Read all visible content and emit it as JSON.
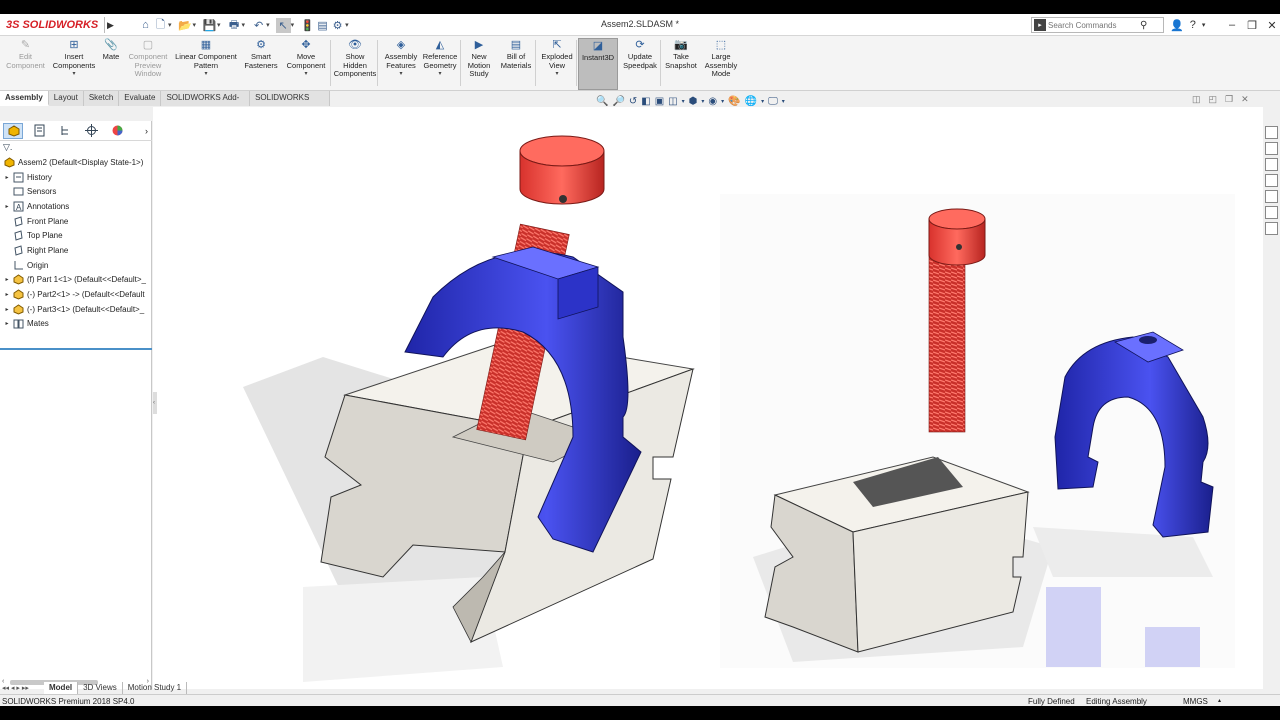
{
  "app": {
    "logo_ds": "3S",
    "logo_name": "SOLIDWORKS",
    "document_title": "Assem2.SLDASM *",
    "search_placeholder": "Search Commands"
  },
  "colors": {
    "brand_red": "#d61f26",
    "ribbon_active": "#bdbdbd",
    "part_red": "#e8463f",
    "part_blue": "#2a2fc4",
    "vblock": "#e8e6e0"
  },
  "ribbon": [
    {
      "label": "Edit\nComponent",
      "icon": "edit-component-icon",
      "disabled": true
    },
    {
      "label": "Insert\nComponents",
      "icon": "insert-components-icon",
      "dropdown": true
    },
    {
      "label": "Mate",
      "icon": "mate-icon"
    },
    {
      "label": "Component\nPreview\nWindow",
      "icon": "preview-window-icon",
      "disabled": true
    },
    {
      "label": "Linear Component\nPattern",
      "icon": "pattern-icon",
      "dropdown": true
    },
    {
      "label": "Smart\nFasteners",
      "icon": "fasteners-icon"
    },
    {
      "label": "Move\nComponent",
      "icon": "move-component-icon",
      "dropdown": true
    },
    {
      "label": "Show\nHidden\nComponents",
      "icon": "show-hidden-icon"
    },
    {
      "label": "Assembly\nFeatures",
      "icon": "assembly-features-icon",
      "dropdown": true
    },
    {
      "label": "Reference\nGeometry",
      "icon": "reference-geometry-icon",
      "dropdown": true
    },
    {
      "label": "New\nMotion\nStudy",
      "icon": "motion-study-icon"
    },
    {
      "label": "Bill of\nMaterials",
      "icon": "bom-icon"
    },
    {
      "label": "Exploded\nView",
      "icon": "exploded-view-icon",
      "dropdown": true
    },
    {
      "label": "Instant3D",
      "icon": "instant3d-icon",
      "active": true
    },
    {
      "label": "Update\nSpeedpak",
      "icon": "speedpak-icon"
    },
    {
      "label": "Take\nSnapshot",
      "icon": "snapshot-icon"
    },
    {
      "label": "Large\nAssembly\nMode",
      "icon": "large-assembly-icon"
    }
  ],
  "cm_tabs": [
    "Assembly",
    "Layout",
    "Sketch",
    "Evaluate",
    "SOLIDWORKS Add-Ins",
    "SOLIDWORKS MBD"
  ],
  "tree": [
    {
      "label": "Assem2  (Default<Display State-1>)",
      "icon": "assembly-icon",
      "twist": false,
      "indent": 0
    },
    {
      "label": "History",
      "icon": "history-icon",
      "twist": true,
      "indent": 1
    },
    {
      "label": "Sensors",
      "icon": "sensors-icon",
      "twist": false,
      "indent": 1
    },
    {
      "label": "Annotations",
      "icon": "annotations-icon",
      "twist": true,
      "indent": 1
    },
    {
      "label": "Front Plane",
      "icon": "plane-icon",
      "twist": false,
      "indent": 1
    },
    {
      "label": "Top Plane",
      "icon": "plane-icon",
      "twist": false,
      "indent": 1
    },
    {
      "label": "Right Plane",
      "icon": "plane-icon",
      "twist": false,
      "indent": 1
    },
    {
      "label": "Origin",
      "icon": "origin-icon",
      "twist": false,
      "indent": 1
    },
    {
      "label": "(f) Part 1<1> (Default<<Default>_",
      "icon": "part-icon",
      "twist": true,
      "indent": 1
    },
    {
      "label": "(-) Part2<1> -> (Default<<Default",
      "icon": "part-icon",
      "twist": true,
      "indent": 1
    },
    {
      "label": "(-) Part3<1> (Default<<Default>_",
      "icon": "part-icon",
      "twist": true,
      "indent": 1
    },
    {
      "label": "Mates",
      "icon": "mates-icon",
      "twist": true,
      "indent": 1
    }
  ],
  "bottom_tabs": [
    "Model",
    "3D Views",
    "Motion Study 1"
  ],
  "status": {
    "product": "SOLIDWORKS Premium 2018 SP4.0",
    "defined": "Fully Defined",
    "mode": "Editing Assembly",
    "units": "MMGS"
  }
}
